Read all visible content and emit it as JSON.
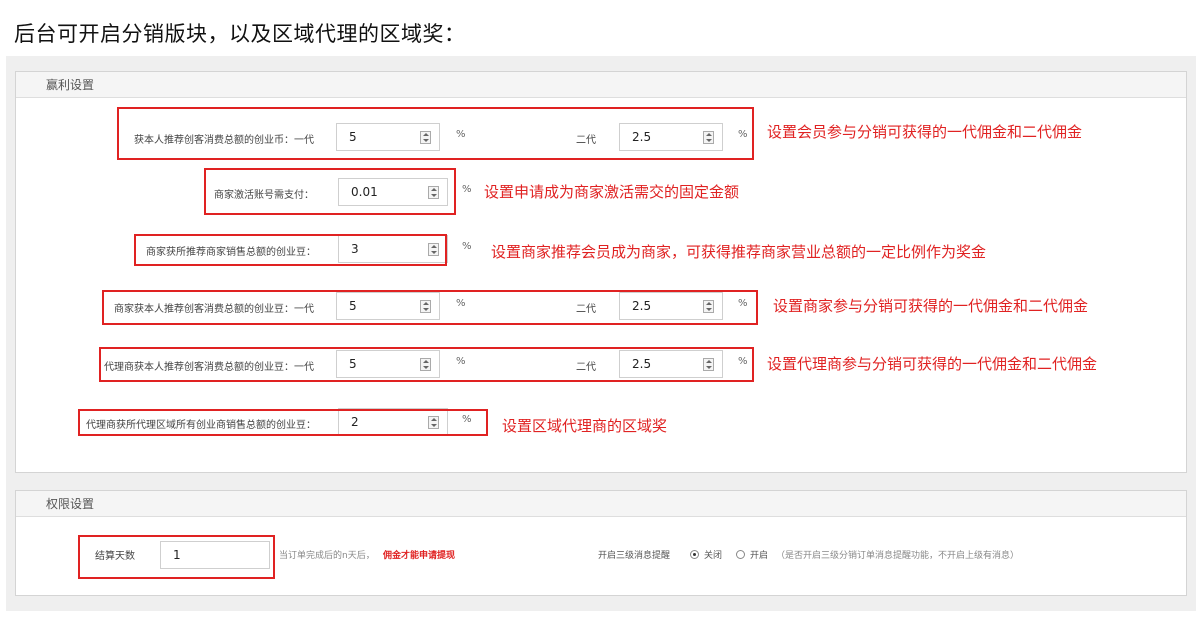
{
  "heading": "后台可开启分销版块，以及区域代理的区域奖：",
  "profit_panel": {
    "title": "赢利设置",
    "rows": [
      {
        "label": "获本人推荐创客消费总额的创业币：一代",
        "value1": "5",
        "pct1": "%",
        "label2": "二代",
        "value2": "2.5",
        "pct2": "%",
        "note": "设置会员参与分销可获得的一代佣金和二代佣金"
      },
      {
        "label": "商家激活账号需支付：",
        "value1": "0.01",
        "pct1": "%",
        "note": "设置申请成为商家激活需交的固定金额"
      },
      {
        "label": "商家获所推荐商家销售总额的创业豆：",
        "value1": "3",
        "pct1": "%",
        "note": "设置商家推荐会员成为商家，可获得推荐商家营业总额的一定比例作为奖金"
      },
      {
        "label": "商家获本人推荐创客消费总额的创业豆：一代",
        "value1": "5",
        "pct1": "%",
        "label2": "二代",
        "value2": "2.5",
        "pct2": "%",
        "note": "设置商家参与分销可获得的一代佣金和二代佣金"
      },
      {
        "label": "代理商获本人推荐创客消费总额的创业豆：一代",
        "value1": "5",
        "pct1": "%",
        "label2": "二代",
        "value2": "2.5",
        "pct2": "%",
        "note": "设置代理商参与分销可获得的一代佣金和二代佣金"
      },
      {
        "label": "代理商获所代理区域所有创业商销售总额的创业豆：",
        "value1": "2",
        "pct1": "%",
        "note": "设置区域代理商的区域奖"
      }
    ]
  },
  "permission_panel": {
    "title": "权限设置",
    "settle_label": "结算天数",
    "settle_value": "1",
    "settle_hint": "当订单完成后的n天后，",
    "settle_hint_red": "佣金才能申请提现",
    "notify_label": "开启三级消息提醒",
    "option_off": "关闭",
    "option_on": "开启",
    "option_hint": "（是否开启三级分销订单消息提醒功能，不开启上级有消息）"
  },
  "colors": {
    "annotation_red": "#e02222",
    "panel_bg": "#efefef"
  }
}
